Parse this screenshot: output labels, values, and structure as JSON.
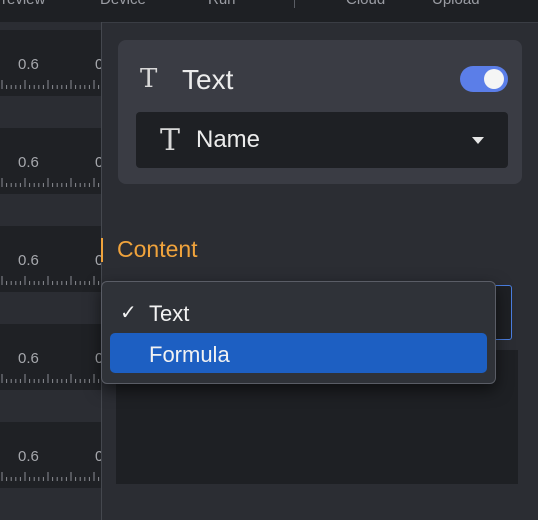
{
  "toolbar": {
    "tabs": [
      "Preview",
      "Device",
      "Run",
      "Cloud",
      "Upload"
    ]
  },
  "tracks": {
    "rows": [
      {
        "value": "0.6",
        "next_value": "0"
      },
      {
        "value": "0.6",
        "next_value": "0"
      },
      {
        "value": "0.6",
        "next_value": "0"
      },
      {
        "value": "0.6",
        "next_value": "0"
      },
      {
        "value": "0.6",
        "next_value": "0"
      }
    ]
  },
  "panel": {
    "icon": "text-icon",
    "title": "Text",
    "enabled": true,
    "select": {
      "icon": "text-icon",
      "value": "Name"
    },
    "content_label": "Content"
  },
  "dropdown": {
    "options": [
      {
        "label": "Text",
        "checked": true,
        "highlighted": false
      },
      {
        "label": "Formula",
        "checked": false,
        "highlighted": true
      }
    ]
  },
  "colors": {
    "accent": "#5b7ee8",
    "highlight": "#1d5fc2",
    "content_label": "#f0a33c"
  }
}
